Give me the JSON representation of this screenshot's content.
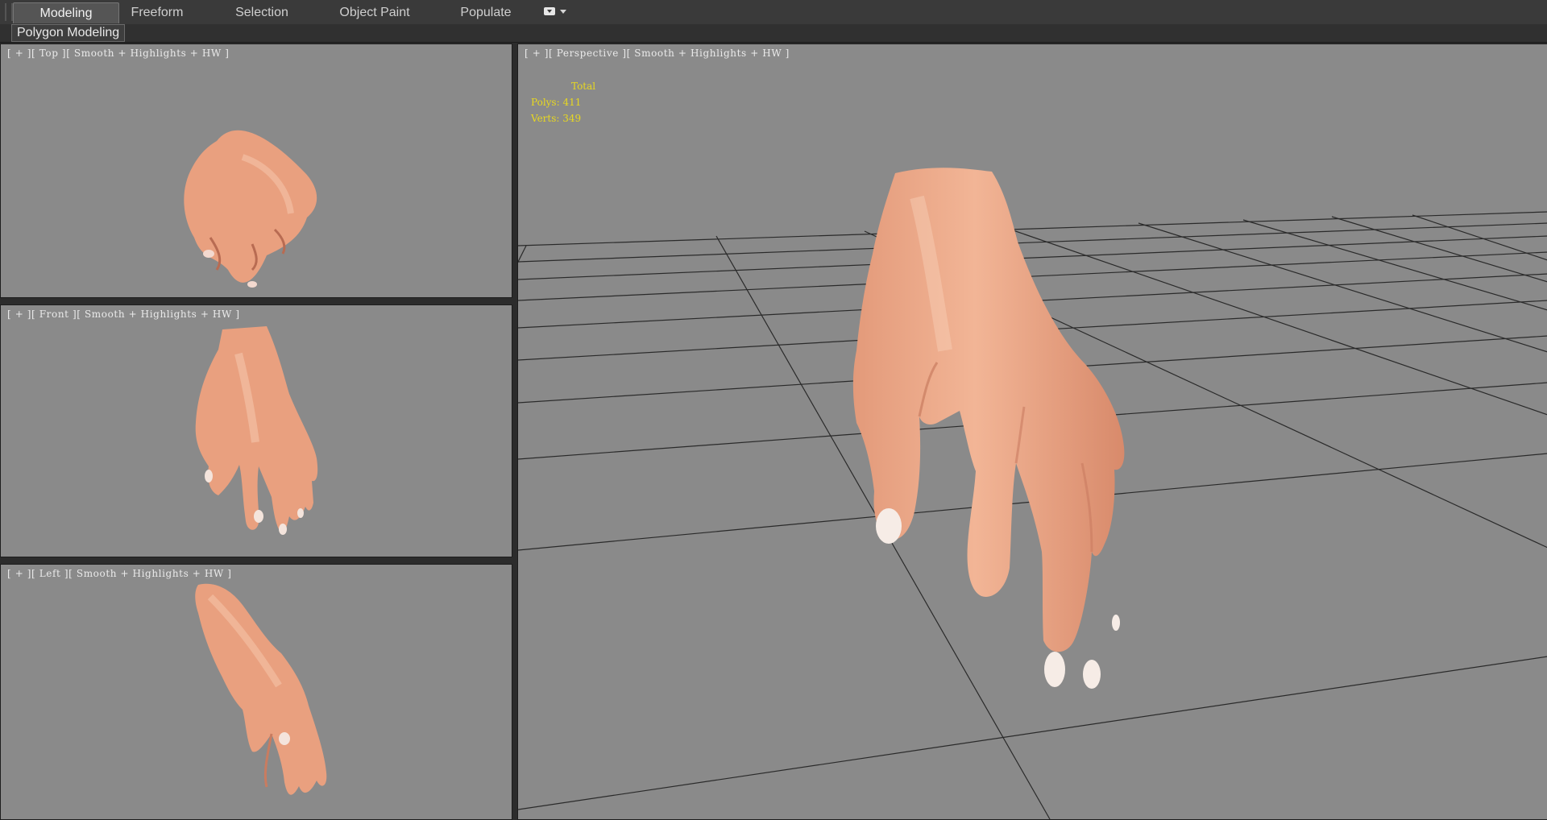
{
  "ribbon": {
    "tabs": [
      {
        "label": "Modeling",
        "active": true
      },
      {
        "label": "Freeform",
        "active": false
      },
      {
        "label": "Selection",
        "active": false
      },
      {
        "label": "Object Paint",
        "active": false
      },
      {
        "label": "Populate",
        "active": false
      }
    ],
    "dropdown_icon": "caret-menu-icon",
    "panel_label": "Polygon Modeling"
  },
  "viewports": {
    "top": {
      "label": "[ + ][ Top ][ Smooth + Highlights + HW ]"
    },
    "front": {
      "label": "[ + ][ Front ][ Smooth + Highlights + HW ]"
    },
    "left": {
      "label": "[ + ][ Left ][ Smooth + Highlights + HW ]"
    },
    "perspective": {
      "label": "[ + ][ Perspective ][ Smooth + Highlights + HW ]"
    }
  },
  "stats": {
    "total_label": "Total",
    "polys_label": "Polys:",
    "polys_value": "411",
    "verts_label": "Verts:",
    "verts_value": "349"
  },
  "colors": {
    "viewport_bg": "#8a8a8a",
    "skin": "#e9a07f",
    "stats_text": "#e8d820",
    "grid_line": "#222222"
  }
}
